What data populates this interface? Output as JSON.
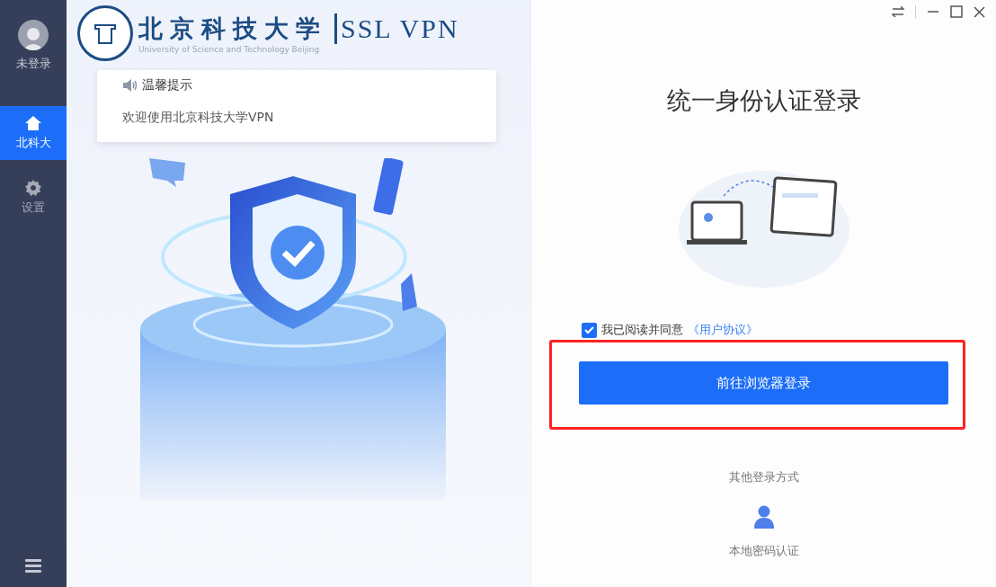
{
  "sidebar": {
    "user": {
      "label": "未登录"
    },
    "items": [
      {
        "label": "北科大",
        "kind": "home",
        "selected": true
      },
      {
        "label": "设置",
        "kind": "settings",
        "selected": false
      }
    ]
  },
  "header": {
    "logo_name": "北京科技大学",
    "logo_product": "SSL VPN",
    "logo_english": "University of Science and Technology Beijing"
  },
  "notice": {
    "title": "温馨提示",
    "message": "欢迎使用北京科技大学VPN"
  },
  "login": {
    "title": "统一身份认证登录",
    "agreement": {
      "checked": true,
      "text": "我已阅读并同意",
      "link": "《用户协议》"
    },
    "button": "前往浏览器登录",
    "other_title": "其他登录方式",
    "other_methods": [
      {
        "label": "本地密码认证"
      }
    ]
  }
}
